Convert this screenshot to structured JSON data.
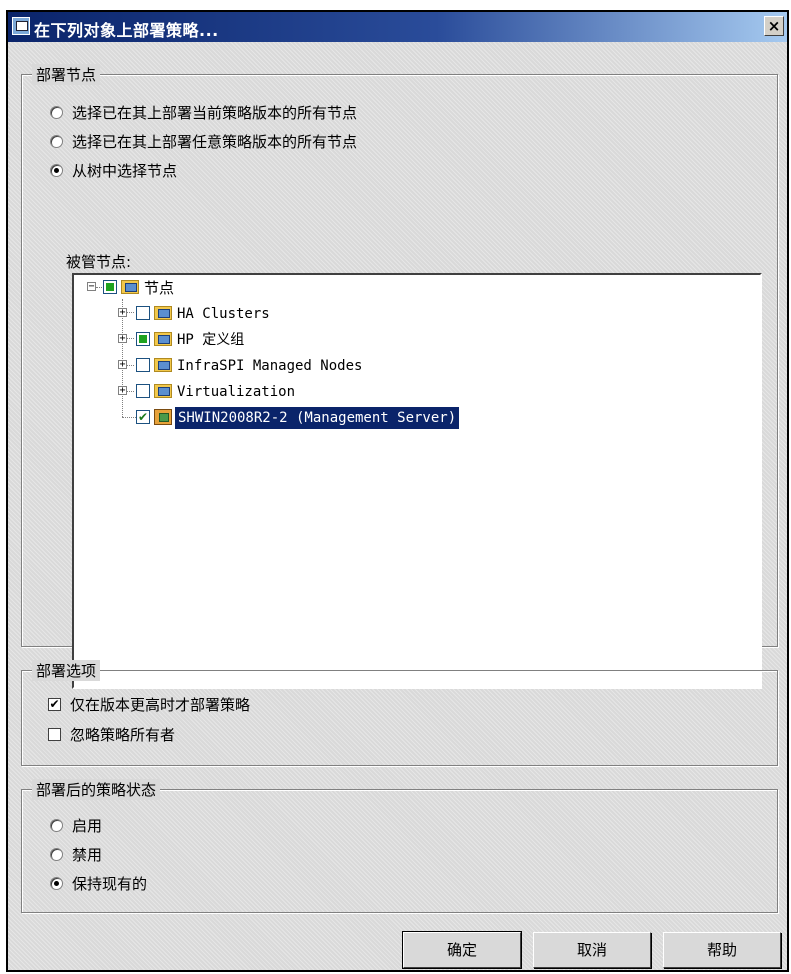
{
  "window": {
    "title": "在下列对象上部署策略...",
    "close_label": "×"
  },
  "deploy_nodes": {
    "legend": "部署节点",
    "options": [
      {
        "label": "选择已在其上部署当前策略版本的所有节点",
        "selected": false
      },
      {
        "label": "选择已在其上部署任意策略版本的所有节点",
        "selected": false
      },
      {
        "label": "从树中选择节点",
        "selected": true
      }
    ],
    "tree_label": "被管节点:",
    "tree": {
      "root": {
        "label": "节点",
        "state": "partial",
        "expander": "−"
      },
      "children": [
        {
          "label": "HA Clusters",
          "state": "unchecked",
          "expander": "+",
          "icon": "folder-icon"
        },
        {
          "label": "HP 定义组",
          "state": "partial",
          "expander": "+",
          "icon": "folder-icon"
        },
        {
          "label": "InfraSPI Managed Nodes",
          "state": "unchecked",
          "expander": "+",
          "icon": "folder-icon"
        },
        {
          "label": "Virtualization",
          "state": "unchecked",
          "expander": "+",
          "icon": "folder-icon"
        },
        {
          "label": "SHWIN2008R2-2 (Management Server)",
          "state": "checked",
          "icon": "server-icon",
          "selected": true
        }
      ]
    }
  },
  "deploy_options": {
    "legend": "部署选项",
    "items": [
      {
        "label": "仅在版本更高时才部署策略",
        "checked": true
      },
      {
        "label": "忽略策略所有者",
        "checked": false
      }
    ]
  },
  "post_state": {
    "legend": "部署后的策略状态",
    "options": [
      {
        "label": "启用",
        "selected": false
      },
      {
        "label": "禁用",
        "selected": false
      },
      {
        "label": "保持现有的",
        "selected": true
      }
    ]
  },
  "buttons": {
    "ok": "确定",
    "cancel": "取消",
    "help": "帮助"
  },
  "marks": {
    "check": "✔"
  }
}
